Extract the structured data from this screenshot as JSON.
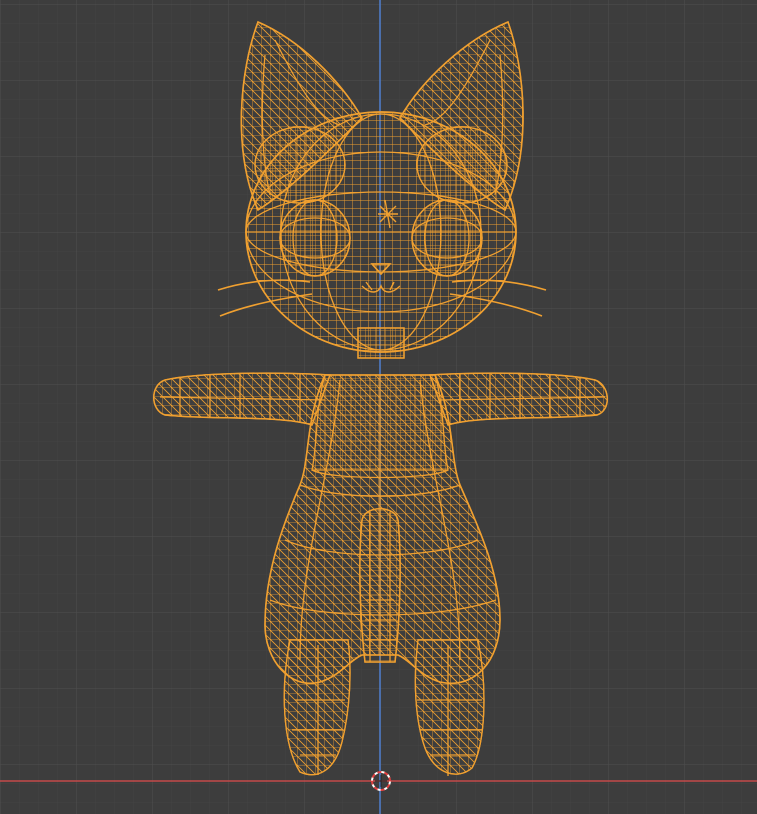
{
  "viewport": {
    "background": "#3d3d3d",
    "grid_minor_color": "#454545",
    "grid_major_color": "#505050",
    "axis_y_color": "#4f7fcf",
    "axis_x_color": "#c44a4a",
    "wire_color": "#f0a030",
    "wire_dark_color": "#d98a1f"
  },
  "scene": {
    "object": "cat-mesh-wireframe",
    "origin": "3d-cursor"
  }
}
